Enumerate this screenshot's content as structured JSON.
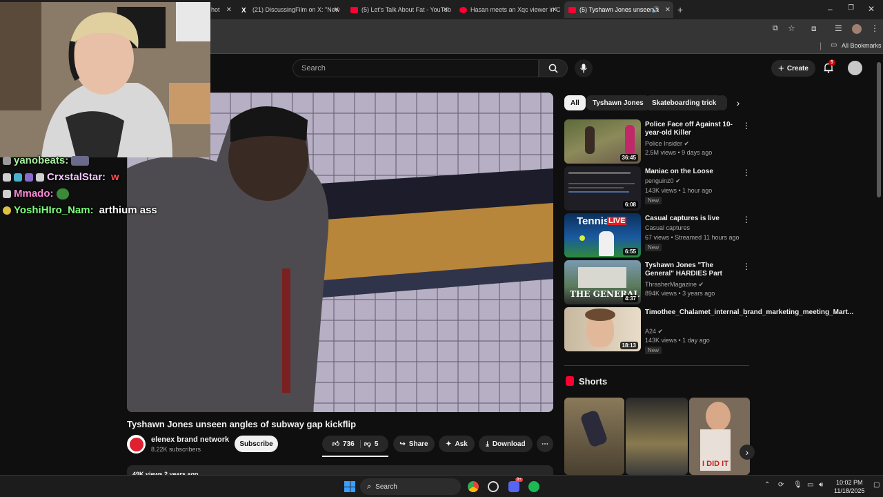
{
  "browser": {
    "tabs": [
      {
        "title": "hot",
        "favicon": "x"
      },
      {
        "title": "(21) DiscussingFilm on X: \"New",
        "favicon": "x-logo-icon"
      },
      {
        "title": "(5) Let's Talk About Fat - YouTub",
        "favicon": "youtube-icon"
      },
      {
        "title": "Hasan meets an Xqc viewer in C",
        "favicon": "youtube-icon"
      },
      {
        "title": "(5) Tyshawn Jones unseen a",
        "favicon": "youtube-icon",
        "active": true
      }
    ],
    "bookmarks_label": "All Bookmarks"
  },
  "header": {
    "search_placeholder": "Search",
    "create_label": "Create",
    "notification_count": "5"
  },
  "video": {
    "title": "Tyshawn Jones unseen angles of subway gap kickflip",
    "channel": "elenex brand network",
    "subscribers": "8.22K subscribers",
    "subscribe_label": "Subscribe",
    "likes": "736",
    "dislikes": "5",
    "share_label": "Share",
    "ask_label": "Ask",
    "download_label": "Download",
    "description_peek": "49K views  2 years ago"
  },
  "chips": [
    "All",
    "Tyshawn Jones",
    "Skateboarding trick"
  ],
  "recommendations": [
    {
      "title": "Police Face off Against 10-year-old Killer",
      "channel": "Police Insider",
      "verified": true,
      "meta": "2.5M views • 9 days ago",
      "duration": "36:45",
      "new": false
    },
    {
      "title": "Maniac on the Loose",
      "channel": "penguinz0",
      "verified": true,
      "meta": "143K views • 1 hour ago",
      "duration": "6:08",
      "new": true
    },
    {
      "title": "Casual captures  is live",
      "channel": "Casual captures",
      "verified": false,
      "meta": "67 views • Streamed 11 hours ago",
      "duration": "6:55",
      "new": true,
      "thumb_text": "Tennis",
      "live_label": "LIVE"
    },
    {
      "title": "Tyshawn Jones \"The General\" HARDIES Part",
      "channel": "ThrasherMagazine",
      "verified": true,
      "meta": "894K views • 3 years ago",
      "duration": "4:37",
      "new": false,
      "thumb_text": "THE GENERAL"
    },
    {
      "title": "Timothee_Chalamet_internal_brand_marketing_meeting_Mart...",
      "channel": "A24",
      "verified": true,
      "meta": "143K views • 1 day ago",
      "duration": "18:13",
      "new": true
    }
  ],
  "new_badge": "New",
  "shorts_label": "Shorts",
  "shorts_book_text": "I DID IT",
  "chat": [
    {
      "user": "yanobeats:",
      "message": "",
      "color": "#a8f0a0"
    },
    {
      "user": "CrxstalStar:",
      "message": "w",
      "color": "#f0c8ff",
      "msg_color": "#ff5050"
    },
    {
      "user": "Mmado:",
      "message": "",
      "color": "#ff8ad8"
    },
    {
      "user": "YoshiHIro_Nam:",
      "message": "arthium ass",
      "color": "#7dff7d"
    }
  ],
  "taskbar": {
    "search_label": "Search",
    "time": "10:02 PM",
    "date": "11/18/2025",
    "discord_badge": "9+"
  },
  "colors": {
    "accent_red": "#ff0033",
    "bg": "#0f0f0f"
  }
}
